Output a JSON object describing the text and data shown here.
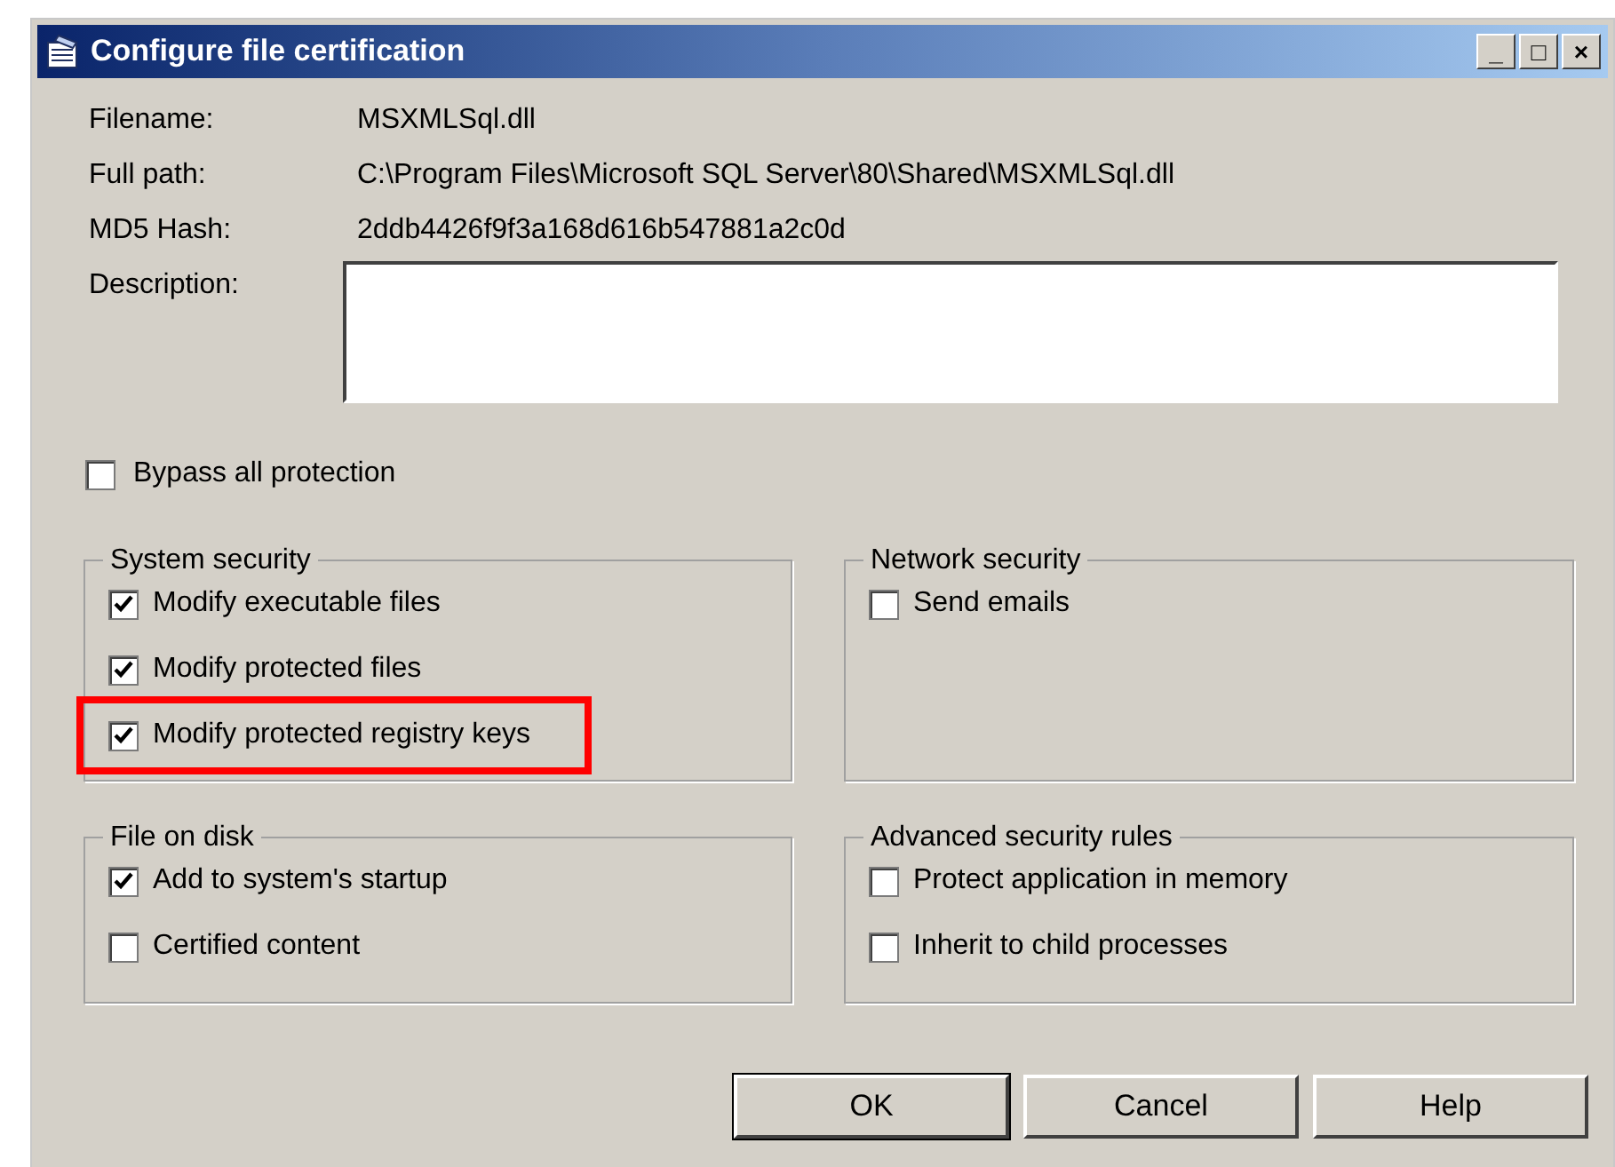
{
  "window": {
    "title": "Configure file certification",
    "controls": [
      "_",
      "□",
      "×"
    ]
  },
  "fields": [
    {
      "label": "Filename:",
      "value": "MSXMLSql.dll"
    },
    {
      "label": "Full path:",
      "value": "C:\\Program Files\\Microsoft  SQL  Server\\80\\Shared\\MSXMLSql.dll"
    },
    {
      "label": "MD5 Hash:",
      "value": "2ddb4426f9f3a168d616b547881a2c0d"
    }
  ],
  "description": {
    "label": "Description:"
  },
  "bypass": {
    "label": "Bypass all protection",
    "checked": false
  },
  "groups": [
    {
      "title": "System security",
      "items": [
        {
          "label": "Modify executable files",
          "checked": true,
          "highlighted": false
        },
        {
          "label": "Modify protected files",
          "checked": true,
          "highlighted": false
        },
        {
          "label": "Modify protected registry keys",
          "checked": true,
          "highlighted": true
        }
      ]
    },
    {
      "title": "Network security",
      "items": [
        {
          "label": "Send emails",
          "checked": false,
          "highlighted": false
        }
      ]
    },
    {
      "title": "File on disk",
      "items": [
        {
          "label": "Add to system's startup",
          "checked": true,
          "highlighted": false
        },
        {
          "label": "Certified content",
          "checked": false,
          "highlighted": false
        }
      ]
    },
    {
      "title": "Advanced security rules",
      "items": [
        {
          "label": "Protect application in memory",
          "checked": false,
          "highlighted": false
        },
        {
          "label": "Inherit to child processes",
          "checked": false,
          "highlighted": false
        }
      ]
    }
  ],
  "buttons": [
    {
      "label": "OK",
      "default": true
    },
    {
      "label": "Cancel",
      "default": false
    },
    {
      "label": "Help",
      "default": false
    }
  ]
}
